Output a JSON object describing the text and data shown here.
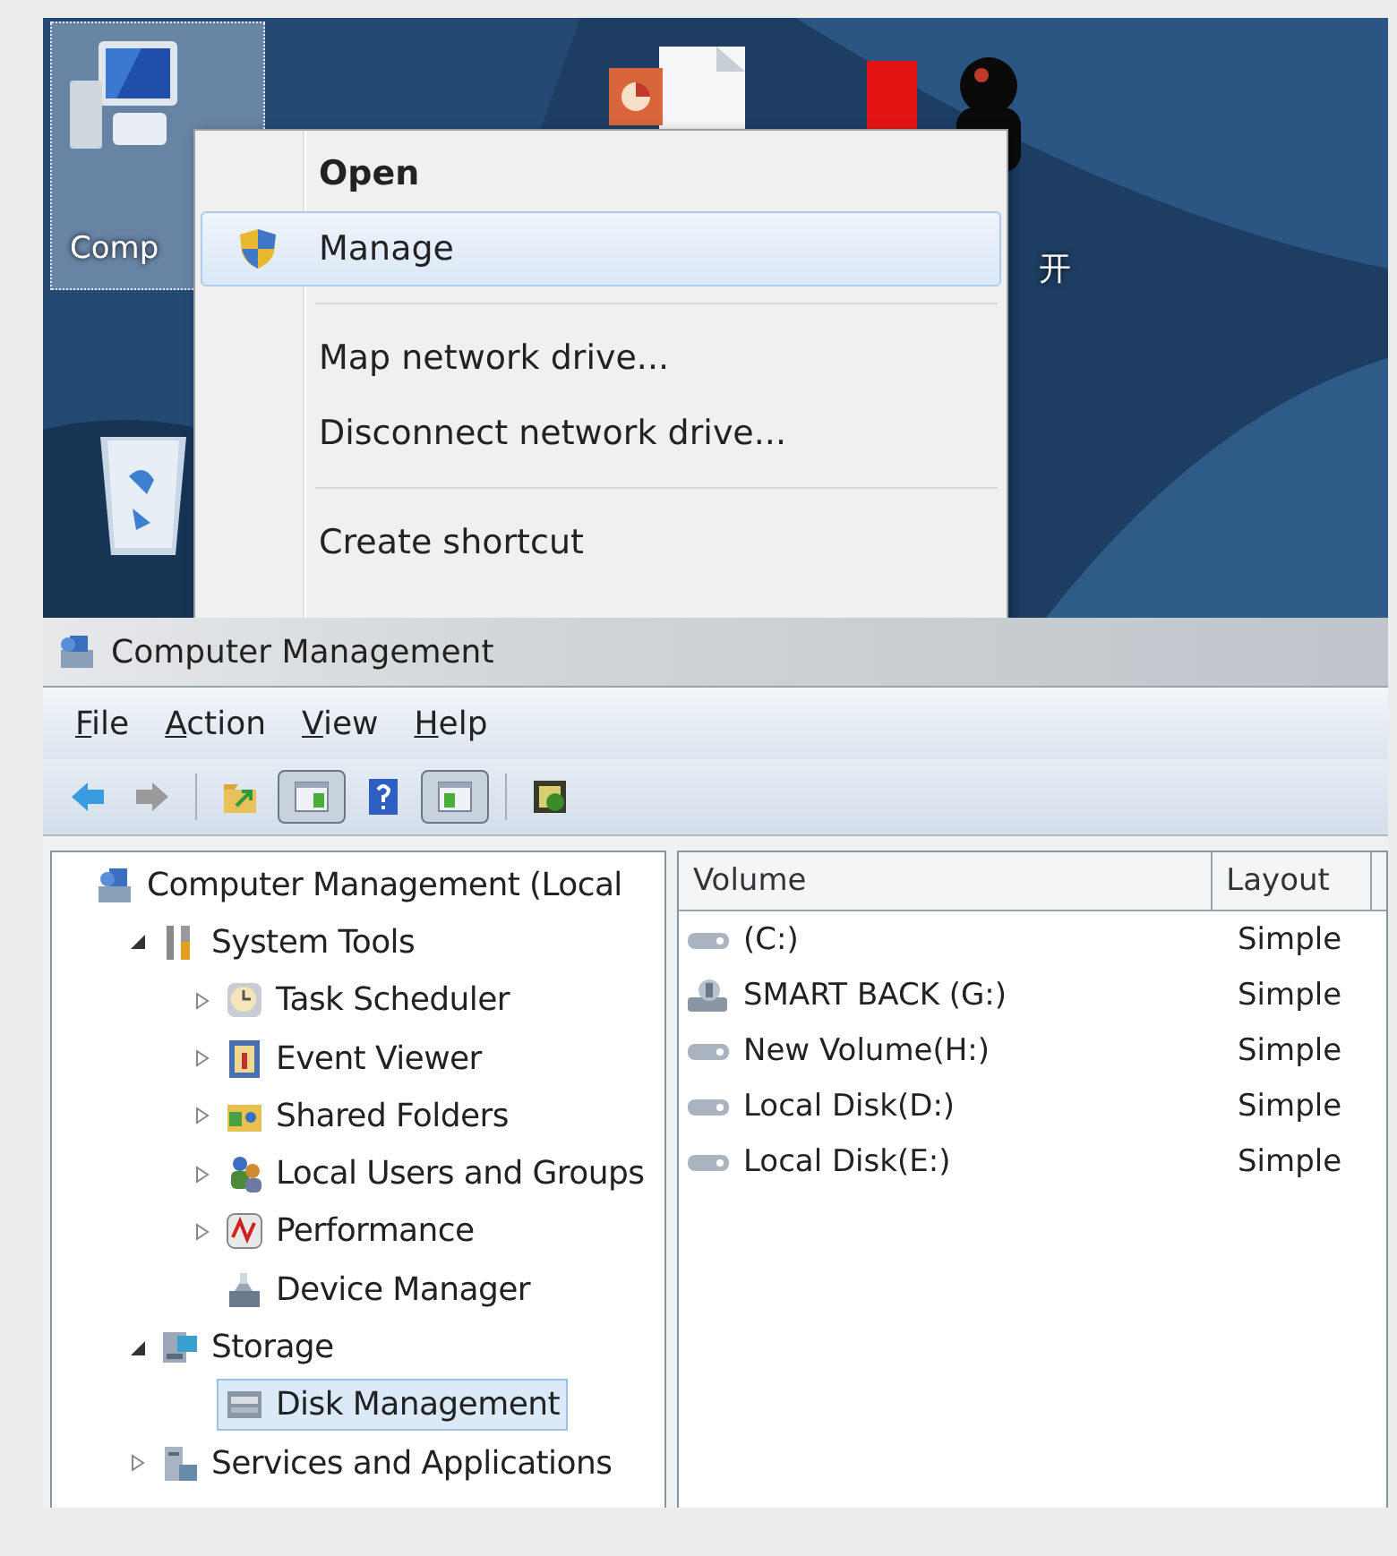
{
  "desktop": {
    "icons": [
      {
        "label": "Comp",
        "selected": true
      },
      {
        "selected": false
      },
      {
        "selected": false
      },
      {
        "label": "开",
        "selected": false
      },
      {
        "selected": false
      }
    ],
    "context_menu": [
      {
        "kind": "default",
        "label": "Open",
        "selected": false
      },
      {
        "kind": "admin",
        "label": "Manage",
        "selected": true
      },
      {
        "kind": "separator"
      },
      {
        "kind": "item",
        "label": "Map network drive...",
        "selected": false
      },
      {
        "kind": "item",
        "label": "Disconnect network drive...",
        "selected": false
      },
      {
        "kind": "separator"
      },
      {
        "kind": "item",
        "label": "Create shortcut",
        "selected": false
      }
    ]
  },
  "window": {
    "title": "Computer Management",
    "menu": [
      "File",
      "Action",
      "View",
      "Help"
    ],
    "toolbar": [
      {
        "kind": "button",
        "pressed": false
      },
      {
        "kind": "button",
        "pressed": false
      },
      {
        "kind": "separator"
      },
      {
        "kind": "button",
        "pressed": false
      },
      {
        "kind": "button",
        "pressed": true
      },
      {
        "kind": "button",
        "pressed": false
      },
      {
        "kind": "button",
        "pressed": true
      },
      {
        "kind": "separator"
      },
      {
        "kind": "button",
        "pressed": false
      }
    ],
    "tree": [
      {
        "label": "Computer Management (Local",
        "selected": false,
        "children": [
          {
            "label": "System Tools",
            "expanded": true,
            "selected": false,
            "children": [
              {
                "label": "Task Scheduler",
                "expanded": false,
                "selected": false
              },
              {
                "label": "Event Viewer",
                "expanded": false,
                "selected": false
              },
              {
                "label": "Shared Folders",
                "expanded": false,
                "selected": false
              },
              {
                "label": "Local Users and Groups",
                "expanded": false,
                "selected": false
              },
              {
                "label": "Performance",
                "expanded": false,
                "selected": false
              },
              {
                "label": "Device Manager",
                "selected": false
              }
            ]
          },
          {
            "label": "Storage",
            "expanded": true,
            "selected": false,
            "children": [
              {
                "label": "Disk Management",
                "selected": true
              }
            ]
          },
          {
            "label": "Services and Applications",
            "expanded": false,
            "selected": false
          }
        ]
      }
    ],
    "table": {
      "columns": [
        "Volume",
        "Layout"
      ],
      "rows": [
        {
          "volume": "(C:)",
          "layout": "Simple"
        },
        {
          "volume": "SMART BACK (G:)",
          "layout": "Simple"
        },
        {
          "volume": "New Volume(H:)",
          "layout": "Simple"
        },
        {
          "volume": "Local Disk(D:)",
          "layout": "Simple"
        },
        {
          "volume": "Local Disk(E:)",
          "layout": "Simple"
        }
      ]
    }
  }
}
